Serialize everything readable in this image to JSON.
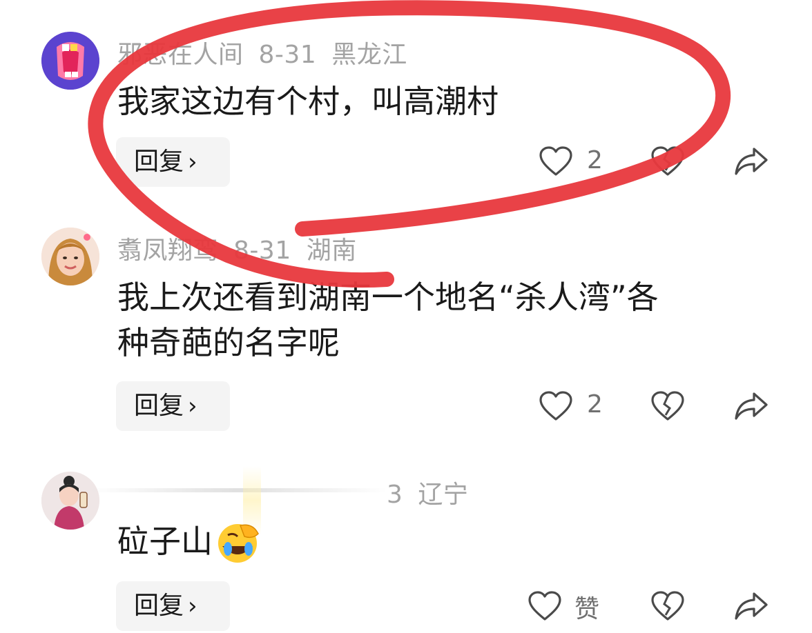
{
  "comments": [
    {
      "username": "邪恶在人间",
      "date": "8-31",
      "location": "黑龙江",
      "text": "我家这边有个村，叫高潮村",
      "reply_label": "回复",
      "reply_chevron": "›",
      "likes": "2",
      "avatar_icon": "cartoon-mouth-avatar"
    },
    {
      "username": "翥凤翔鸾",
      "date": "8-31",
      "location": "湖南",
      "text_line1": "我上次还看到湖南一个地名“杀人湾”各",
      "text_line2": "种奇葩的名字呢",
      "reply_label": "回复",
      "reply_chevron": "›",
      "likes": "2",
      "avatar_icon": "woman-photo-avatar"
    },
    {
      "date_partial": "3",
      "location": "辽宁",
      "text": "砬子山",
      "emoji": "face-palm-laughing-emoji",
      "reply_label": "回复",
      "reply_chevron": "›",
      "likes": "赞",
      "avatar_icon": "cartoon-girl-avatar"
    }
  ],
  "colors": {
    "annotation_red": "#e8383d",
    "meta_gray": "#a3a3a3",
    "text_dark": "#1a1a1a",
    "reply_bg": "#f4f4f4"
  }
}
